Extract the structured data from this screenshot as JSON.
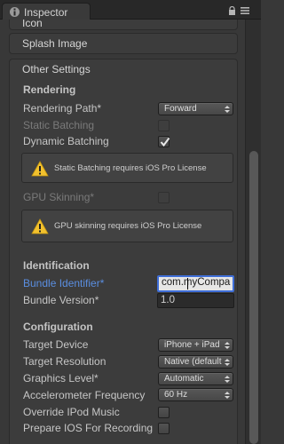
{
  "window": {
    "tab_title": "Inspector"
  },
  "sections": {
    "icon_title": "Icon",
    "splash_title": "Splash Image",
    "other_settings_title": "Other Settings"
  },
  "rendering": {
    "header": "Rendering",
    "rendering_path_label": "Rendering Path*",
    "rendering_path_value": "Forward",
    "static_batching_label": "Static Batching",
    "static_batching_checked": false,
    "dynamic_batching_label": "Dynamic Batching",
    "dynamic_batching_checked": true,
    "static_batching_warning": "Static Batching requires iOS Pro License",
    "gpu_skinning_label": "GPU Skinning*",
    "gpu_skinning_checked": false,
    "gpu_skinning_warning": "GPU skinning requires iOS Pro License"
  },
  "identification": {
    "header": "Identification",
    "bundle_identifier_label": "Bundle Identifier*",
    "bundle_identifier_value": "com.myCompa",
    "bundle_version_label": "Bundle Version*",
    "bundle_version_value": "1.0"
  },
  "configuration": {
    "header": "Configuration",
    "target_device_label": "Target Device",
    "target_device_value": "iPhone + iPad",
    "target_resolution_label": "Target Resolution",
    "target_resolution_value": "Native (default",
    "graphics_level_label": "Graphics Level*",
    "graphics_level_value": "Automatic",
    "accelerometer_label": "Accelerometer Frequency",
    "accelerometer_value": "60 Hz",
    "override_ipod_label": "Override IPod Music",
    "override_ipod_checked": false,
    "prepare_ios_label": "Prepare IOS For Recording",
    "prepare_ios_checked": false
  },
  "colors": {
    "link_label": "#5a8ee0",
    "focus_border": "#3f6ed8",
    "warning_yellow": "#f2c12e"
  }
}
